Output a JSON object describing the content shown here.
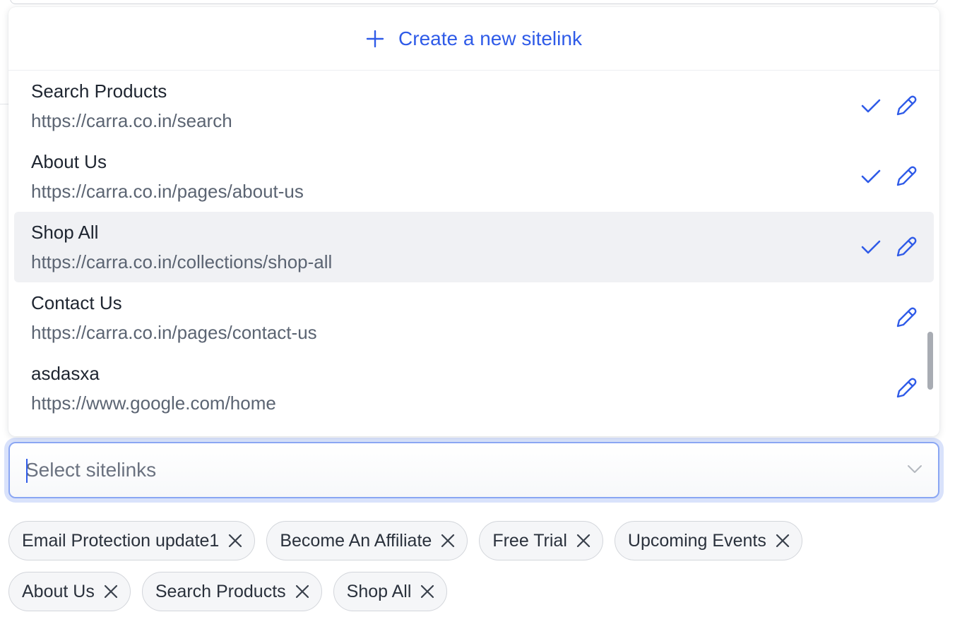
{
  "dropdown": {
    "create_label": "Create a new sitelink",
    "items": [
      {
        "name": "Search Products",
        "url": "https://carra.co.in/search",
        "selected": true,
        "highlighted": false
      },
      {
        "name": "About Us",
        "url": "https://carra.co.in/pages/about-us",
        "selected": true,
        "highlighted": false
      },
      {
        "name": "Shop All",
        "url": "https://carra.co.in/collections/shop-all",
        "selected": true,
        "highlighted": true
      },
      {
        "name": "Contact Us",
        "url": "https://carra.co.in/pages/contact-us",
        "selected": false,
        "highlighted": false
      },
      {
        "name": "asdasxa",
        "url": "https://www.google.com/home",
        "selected": false,
        "highlighted": false
      }
    ]
  },
  "select": {
    "placeholder": "Select sitelinks",
    "value": ""
  },
  "chips": {
    "row1": [
      "Email Protection update1",
      "Become An Affiliate",
      "Free Trial",
      "Upcoming Events"
    ],
    "row2": [
      "About Us",
      "Search Products",
      "Shop All"
    ]
  },
  "colors": {
    "accent": "#2f5be8",
    "highlight": "#f0f1f4",
    "focus_ring": "#8aa6f3"
  },
  "icons": {
    "create": "plus-icon",
    "selected": "check-icon",
    "edit": "pencil-icon",
    "remove": "close-icon",
    "dropdown": "chevron-down-icon"
  }
}
